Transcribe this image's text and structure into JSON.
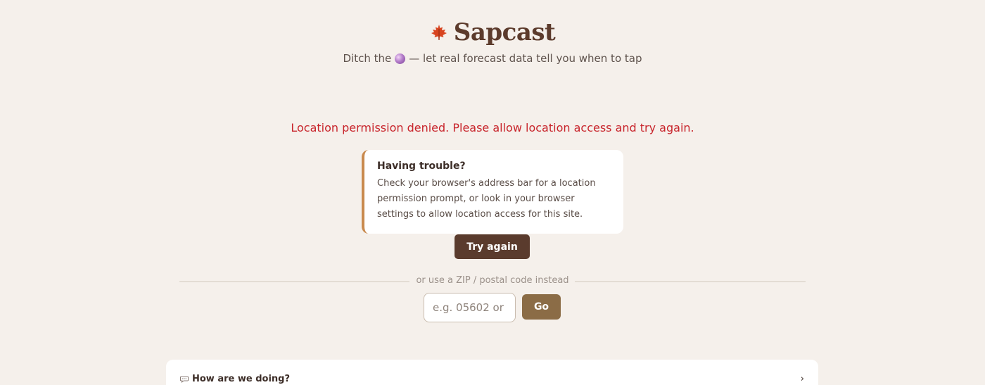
{
  "header": {
    "app_name": "Sapcast",
    "subtitle_before": "Ditch the",
    "subtitle_after": "— let real forecast data tell you when to tap",
    "title_icon": "maple-leaf-icon",
    "subtitle_icon": "crystal-ball-icon"
  },
  "error": {
    "message": "Location permission denied. Please allow location access and try again."
  },
  "trouble": {
    "title": "Having trouble?",
    "body": "Check your browser's address bar for a location permission prompt, or look in your browser settings to allow location access for this site."
  },
  "actions": {
    "try_again_label": "Try again"
  },
  "zip": {
    "divider_label": "or use a ZIP / postal code instead",
    "placeholder": "e.g. 05602 or",
    "go_label": "Go"
  },
  "feedback": {
    "label": "How are we doing?",
    "chevron": "›"
  },
  "colors": {
    "background": "#f5f0eb",
    "brand": "#5c3b2c",
    "error": "#c8242b",
    "accent": "#8b6c46",
    "card_border": "#c98a4e"
  }
}
